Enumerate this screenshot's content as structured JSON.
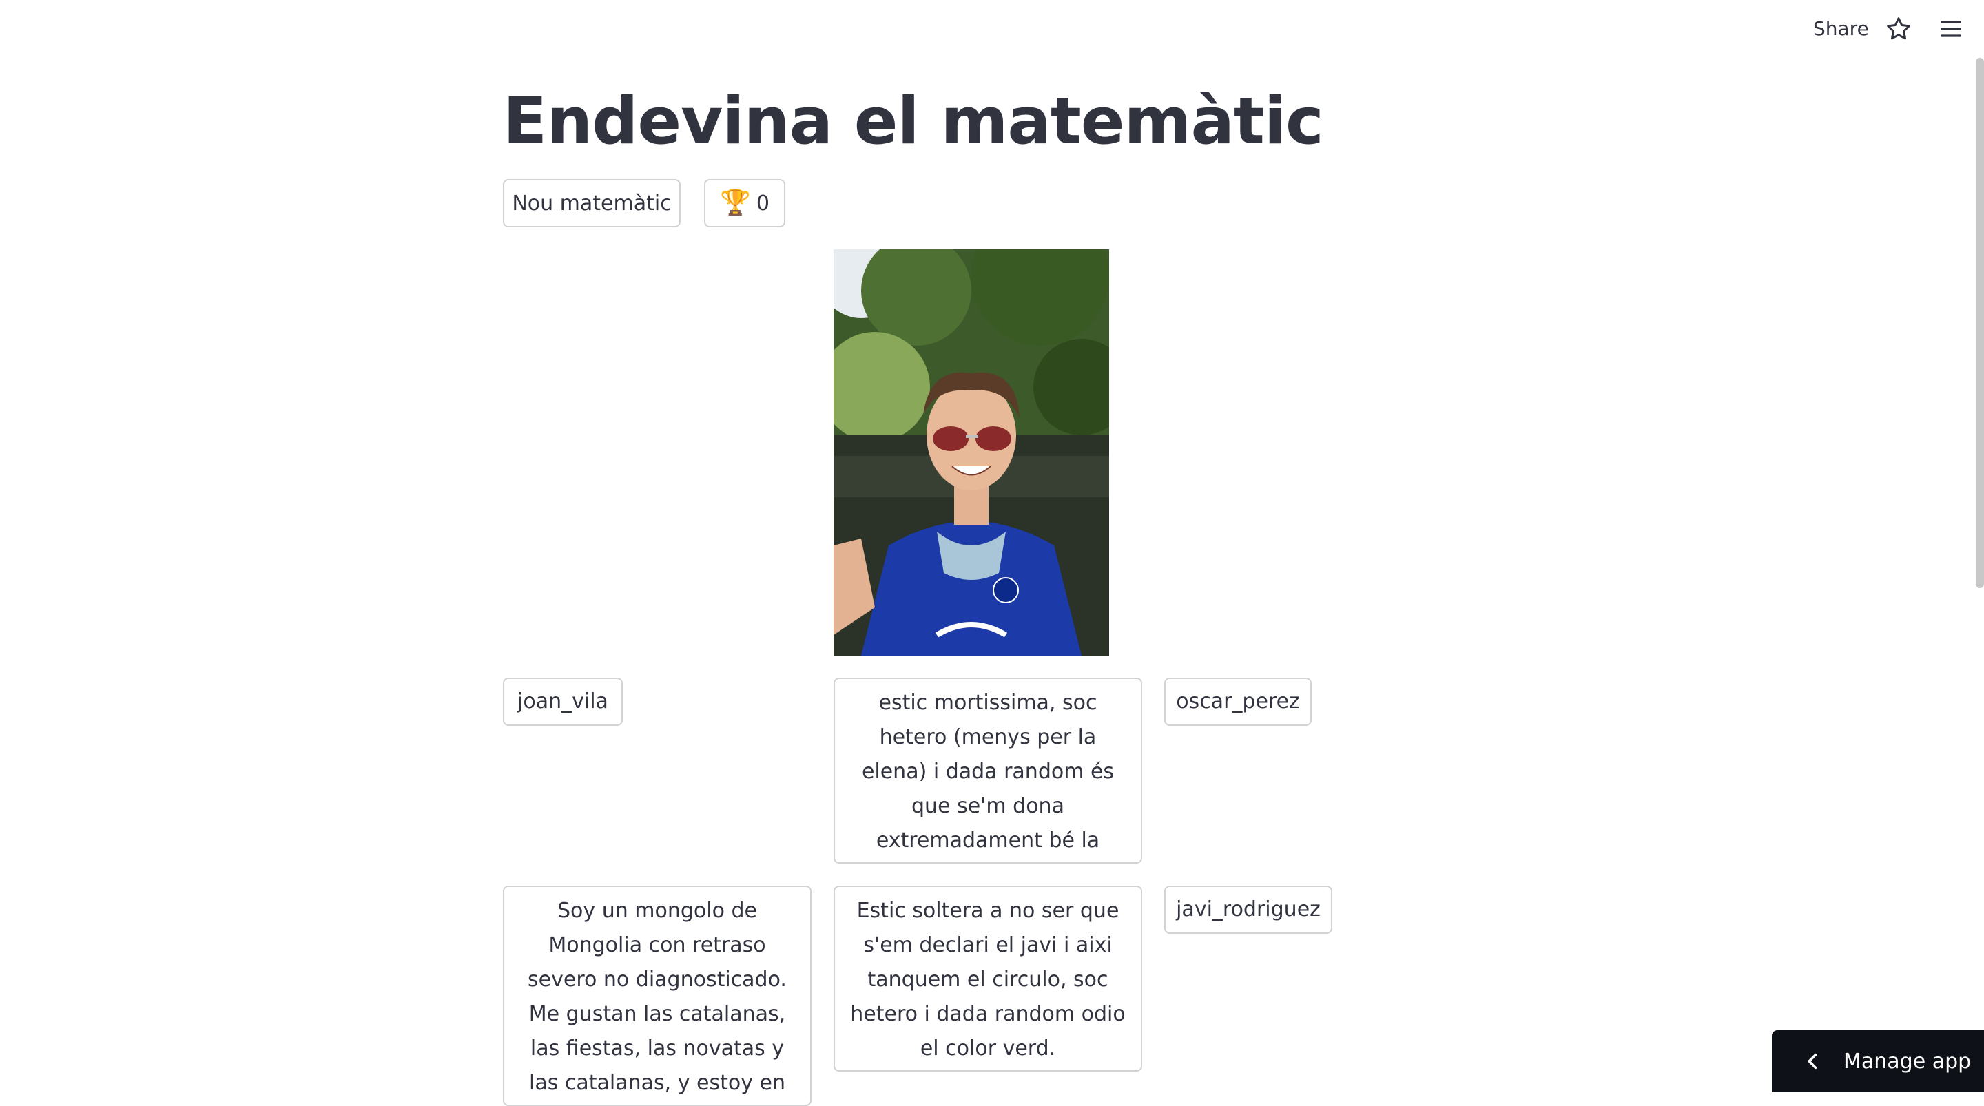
{
  "header": {
    "share_label": "Share",
    "star_icon": "star-icon",
    "menu_icon": "hamburger-menu-icon"
  },
  "main": {
    "title": "Endevina el matemàtic",
    "new_button_label": "Nou matemàtic",
    "score_button": {
      "icon": "trophy-icon",
      "value": "0"
    },
    "photo": {
      "description_icon": "person-photo"
    },
    "options": {
      "joan": "joan_vila",
      "oscar": "oscar_perez",
      "javi": "javi_rodriguez",
      "desc1": "estic mortissima, soc hetero (menys per la elena) i dada random és que se'm dona extremadament bé la informatica ;)",
      "desc2": "Estic soltera a no ser que s'em declari el javi i aixi tanquem el circulo, soc hetero i dada random odio el color verd.",
      "desc3": "Soy un mongolo de Mongolia con retraso severo no diagnosticado. Me gustan las catalanas, las fiestas, las novatas y las catalanas, y estoy en plena"
    }
  },
  "footer": {
    "manage_label": "Manage app",
    "chevron_icon": "chevron-left-icon"
  },
  "colors": {
    "text": "#31333f",
    "border": "#d6d6d9",
    "manage_bg": "#0e1117"
  }
}
